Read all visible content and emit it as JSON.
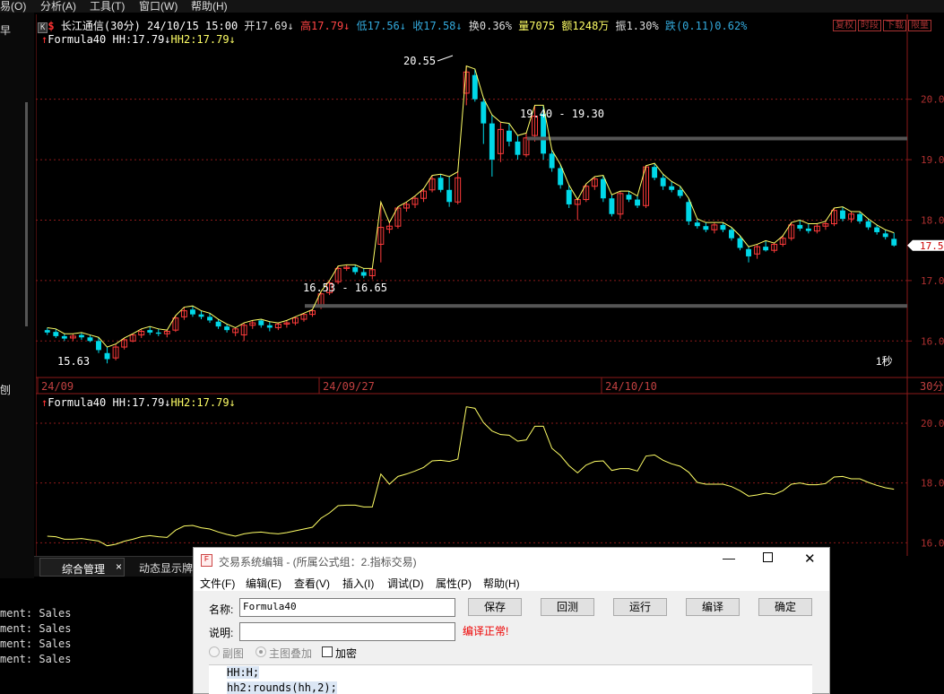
{
  "menu": [
    "易(O)",
    "分析(A)",
    "工具(T)",
    "窗口(W)",
    "帮助(H)"
  ],
  "left": {
    "top_char": "早",
    "mid_char": "刨"
  },
  "info": {
    "title": "长江通信(30分)",
    "date": "24/10/15 15:00",
    "open_label": "开",
    "open": "17.69↓",
    "high_label": "高",
    "high": "17.79↓",
    "low_label": "低",
    "low": "17.56↓",
    "close_label": "收",
    "close": "17.58↓",
    "turnover_label": "换",
    "turnover": "0.36%",
    "vol_label": "量",
    "vol": "7075",
    "amt_label": "额",
    "amt": "1248万",
    "amp_label": "振",
    "amp": "1.30%",
    "chg_label": "跌",
    "chg": "(0.11)0.62%"
  },
  "buttons": {
    "k": "K",
    "fq": "复权",
    "time": "时段",
    "download": "下载",
    "limit": "限量"
  },
  "main_legend": {
    "name": "Formula40",
    "hh": "HH:17.79↓",
    "hh2": "HH2:17.79↓"
  },
  "sub_legend": {
    "name": "Formula40",
    "hh": "HH:17.79↓",
    "hh2": "HH2:17.79↓"
  },
  "annotations": {
    "peak": "20.55",
    "low": "15.63",
    "zone_upper": "19.40 - 19.30",
    "zone_lower": "16.53 - 16.65",
    "timer": "1秒"
  },
  "main_axis": [
    "20.0",
    "19.0",
    "18.0",
    "17.0",
    "16.0"
  ],
  "current_price": "17.5",
  "sub_axis": [
    "20.0",
    "18.0",
    "16.0"
  ],
  "dates": [
    "24/09",
    "24/09/27",
    "24/10/10"
  ],
  "period": "30分",
  "colors": {
    "up": "#ff3b3b",
    "down": "#00d8e8",
    "line": "#ffff66",
    "grid": "#8b1a1a",
    "bg": "#000000"
  },
  "tabs": {
    "main": "综合管理",
    "second": "动态显示牌",
    "close": "×"
  },
  "console": [
    "ment: Sales",
    "ment: Sales",
    "ment: Sales",
    "ment: Sales"
  ],
  "dialog": {
    "title": "交易系统编辑 - (所属公式组：2.指标交易)",
    "menu": [
      "文件(F)",
      "编辑(E)",
      "查看(V)",
      "插入(I)",
      "调试(D)",
      "属性(P)",
      "帮助(H)"
    ],
    "name_label": "名称:",
    "name_value": "Formula40",
    "desc_label": "说明:",
    "desc_value": "",
    "status": "编译正常!",
    "buttons": [
      "保存",
      "回测",
      "运行",
      "编译",
      "确定"
    ],
    "radio1": "副图",
    "radio2": "主图叠加",
    "checkbox": "加密",
    "code": [
      "HH:H;",
      "hh2:rounds(hh,2);"
    ]
  },
  "chart_data": {
    "type": "candlestick",
    "period": "30分",
    "x_ticks": [
      "24/09",
      "24/09/27",
      "24/10/10"
    ],
    "ylim": [
      15.5,
      20.9
    ],
    "candles": [
      [
        16.18,
        16.22,
        16.1,
        16.14
      ],
      [
        16.15,
        16.2,
        16.05,
        16.08
      ],
      [
        16.08,
        16.12,
        16.0,
        16.04
      ],
      [
        16.05,
        16.12,
        16.0,
        16.08
      ],
      [
        16.1,
        16.14,
        16.02,
        16.06
      ],
      [
        16.06,
        16.1,
        15.98,
        16.0
      ],
      [
        16.0,
        16.06,
        15.8,
        15.85
      ],
      [
        15.8,
        15.9,
        15.63,
        15.7
      ],
      [
        15.72,
        15.95,
        15.68,
        15.9
      ],
      [
        15.9,
        16.05,
        15.86,
        16.02
      ],
      [
        16.0,
        16.12,
        15.98,
        16.1
      ],
      [
        16.1,
        16.2,
        16.05,
        16.16
      ],
      [
        16.18,
        16.24,
        16.1,
        16.14
      ],
      [
        16.14,
        16.2,
        16.08,
        16.12
      ],
      [
        16.12,
        16.18,
        16.06,
        16.16
      ],
      [
        16.18,
        16.42,
        16.15,
        16.38
      ],
      [
        16.4,
        16.56,
        16.35,
        16.5
      ],
      [
        16.52,
        16.58,
        16.4,
        16.44
      ],
      [
        16.44,
        16.5,
        16.36,
        16.4
      ],
      [
        16.4,
        16.46,
        16.3,
        16.34
      ],
      [
        16.32,
        16.36,
        16.2,
        16.24
      ],
      [
        16.24,
        16.28,
        16.14,
        16.18
      ],
      [
        16.14,
        16.22,
        16.08,
        16.2
      ],
      [
        16.1,
        16.3,
        16.0,
        16.26
      ],
      [
        16.26,
        16.34,
        16.2,
        16.3
      ],
      [
        16.34,
        16.36,
        16.22,
        16.26
      ],
      [
        16.26,
        16.32,
        16.16,
        16.22
      ],
      [
        16.22,
        16.3,
        16.18,
        16.28
      ],
      [
        16.28,
        16.34,
        16.22,
        16.3
      ],
      [
        16.3,
        16.4,
        16.26,
        16.38
      ],
      [
        16.36,
        16.46,
        16.32,
        16.44
      ],
      [
        16.44,
        16.52,
        16.4,
        16.5
      ],
      [
        16.56,
        16.82,
        16.53,
        16.78
      ],
      [
        16.8,
        17.0,
        16.76,
        16.96
      ],
      [
        16.98,
        17.24,
        16.94,
        17.2
      ],
      [
        17.2,
        17.26,
        17.16,
        17.22
      ],
      [
        17.22,
        17.26,
        17.1,
        17.14
      ],
      [
        17.14,
        17.2,
        17.04,
        17.08
      ],
      [
        17.08,
        17.2,
        17.02,
        17.18
      ],
      [
        17.6,
        18.3,
        17.3,
        17.88
      ],
      [
        17.85,
        17.96,
        17.78,
        17.9
      ],
      [
        17.9,
        18.22,
        17.86,
        18.2
      ],
      [
        18.2,
        18.3,
        18.14,
        18.26
      ],
      [
        18.26,
        18.4,
        18.2,
        18.36
      ],
      [
        18.36,
        18.52,
        18.3,
        18.48
      ],
      [
        18.5,
        18.74,
        18.46,
        18.68
      ],
      [
        18.7,
        18.76,
        18.46,
        18.5
      ],
      [
        18.5,
        18.72,
        18.22,
        18.3
      ],
      [
        18.3,
        18.8,
        18.26,
        18.7
      ],
      [
        20.1,
        20.55,
        19.9,
        20.45
      ],
      [
        20.4,
        20.5,
        19.96,
        20.0
      ],
      [
        19.96,
        20.02,
        19.26,
        19.6
      ],
      [
        19.6,
        19.74,
        18.72,
        19.0
      ],
      [
        19.1,
        19.62,
        18.96,
        19.5
      ],
      [
        19.48,
        19.6,
        19.22,
        19.3
      ],
      [
        19.3,
        19.4,
        19.0,
        19.08
      ],
      [
        19.08,
        19.44,
        19.04,
        19.36
      ],
      [
        19.4,
        19.9,
        19.3,
        19.72
      ],
      [
        19.76,
        19.9,
        19.0,
        19.1
      ],
      [
        19.1,
        19.16,
        18.8,
        18.86
      ],
      [
        18.86,
        18.92,
        18.52,
        18.58
      ],
      [
        18.5,
        18.58,
        18.2,
        18.26
      ],
      [
        18.26,
        18.34,
        18.0,
        18.34
      ],
      [
        18.34,
        18.6,
        18.3,
        18.56
      ],
      [
        18.56,
        18.72,
        18.5,
        18.68
      ],
      [
        18.68,
        18.74,
        18.3,
        18.36
      ],
      [
        18.36,
        18.42,
        18.06,
        18.1
      ],
      [
        18.1,
        18.48,
        18.02,
        18.44
      ],
      [
        18.42,
        18.48,
        18.3,
        18.34
      ],
      [
        18.34,
        18.4,
        18.2,
        18.24
      ],
      [
        18.24,
        18.9,
        18.2,
        18.88
      ],
      [
        18.88,
        18.94,
        18.66,
        18.7
      ],
      [
        18.7,
        18.76,
        18.5,
        18.56
      ],
      [
        18.56,
        18.64,
        18.46,
        18.5
      ],
      [
        18.5,
        18.56,
        18.36,
        18.4
      ],
      [
        18.3,
        18.36,
        17.92,
        17.98
      ],
      [
        17.96,
        18.02,
        17.86,
        17.9
      ],
      [
        17.9,
        17.96,
        17.8,
        17.84
      ],
      [
        17.84,
        17.96,
        17.78,
        17.92
      ],
      [
        17.92,
        17.96,
        17.8,
        17.84
      ],
      [
        17.84,
        17.88,
        17.66,
        17.7
      ],
      [
        17.7,
        17.74,
        17.5,
        17.54
      ],
      [
        17.52,
        17.56,
        17.3,
        17.4
      ],
      [
        17.44,
        17.6,
        17.36,
        17.56
      ],
      [
        17.56,
        17.66,
        17.48,
        17.5
      ],
      [
        17.5,
        17.62,
        17.46,
        17.6
      ],
      [
        17.6,
        17.74,
        17.56,
        17.7
      ],
      [
        17.7,
        17.96,
        17.66,
        17.92
      ],
      [
        17.92,
        18.0,
        17.82,
        17.86
      ],
      [
        17.86,
        17.94,
        17.78,
        17.82
      ],
      [
        17.82,
        17.94,
        17.78,
        17.9
      ],
      [
        17.9,
        17.98,
        17.84,
        17.94
      ],
      [
        17.94,
        18.2,
        17.9,
        18.16
      ],
      [
        18.16,
        18.22,
        17.98,
        18.02
      ],
      [
        18.02,
        18.14,
        17.96,
        18.1
      ],
      [
        18.1,
        18.14,
        17.94,
        17.98
      ],
      [
        17.98,
        18.02,
        17.84,
        17.88
      ],
      [
        17.88,
        17.92,
        17.76,
        17.8
      ],
      [
        17.78,
        17.84,
        17.68,
        17.72
      ],
      [
        17.69,
        17.79,
        17.56,
        17.58
      ]
    ],
    "hh_line_note": "HH = high of each bar (yellow line)",
    "sub_axis": [
      20.0,
      18.0,
      16.0
    ]
  }
}
